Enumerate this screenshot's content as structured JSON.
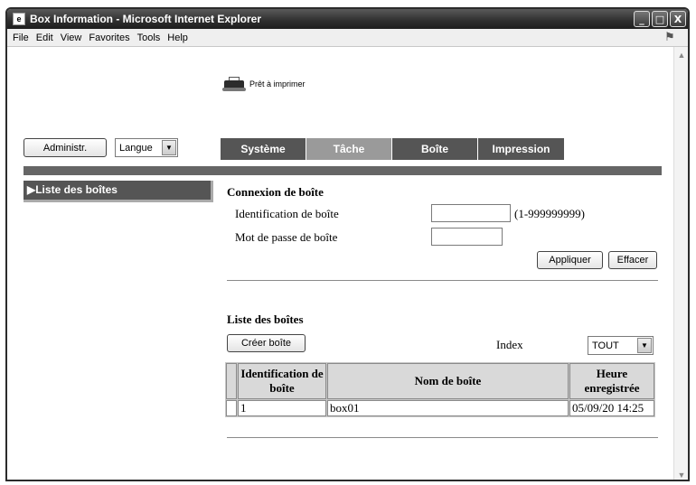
{
  "window": {
    "title": "Box Information - Microsoft Internet Explorer",
    "controls": [
      "_",
      "□",
      "X"
    ]
  },
  "menubar": {
    "items": [
      "File",
      "Edit",
      "View",
      "Favorites",
      "Tools",
      "Help"
    ]
  },
  "status": {
    "printer_text": "Prêt à imprimer"
  },
  "toolbar": {
    "admin_label": "Administr.",
    "language_value": "Langue"
  },
  "tabs": [
    {
      "label": "Système",
      "active": false
    },
    {
      "label": "Tâche",
      "active": true
    },
    {
      "label": "Boîte",
      "active": false
    },
    {
      "label": "Impression",
      "active": false
    }
  ],
  "sidebar": {
    "items": [
      {
        "label": "▶Liste des boîtes"
      }
    ]
  },
  "login": {
    "title": "Connexion de boîte",
    "id_label": "Identification de boîte",
    "id_value": "",
    "id_range": "(1-999999999)",
    "password_label": "Mot de passe de boîte",
    "password_value": "",
    "apply_label": "Appliquer",
    "clear_label": "Effacer"
  },
  "boxlist": {
    "title": "Liste des boîtes",
    "create_label": "Créer boîte",
    "index_label": "Index",
    "index_value": "TOUT",
    "columns": [
      "Identification de boîte",
      "Nom de boîte",
      "Heure enregistrée"
    ],
    "rows": [
      {
        "id": "1",
        "name": "box01",
        "time": "05/09/20 14:25"
      }
    ]
  }
}
